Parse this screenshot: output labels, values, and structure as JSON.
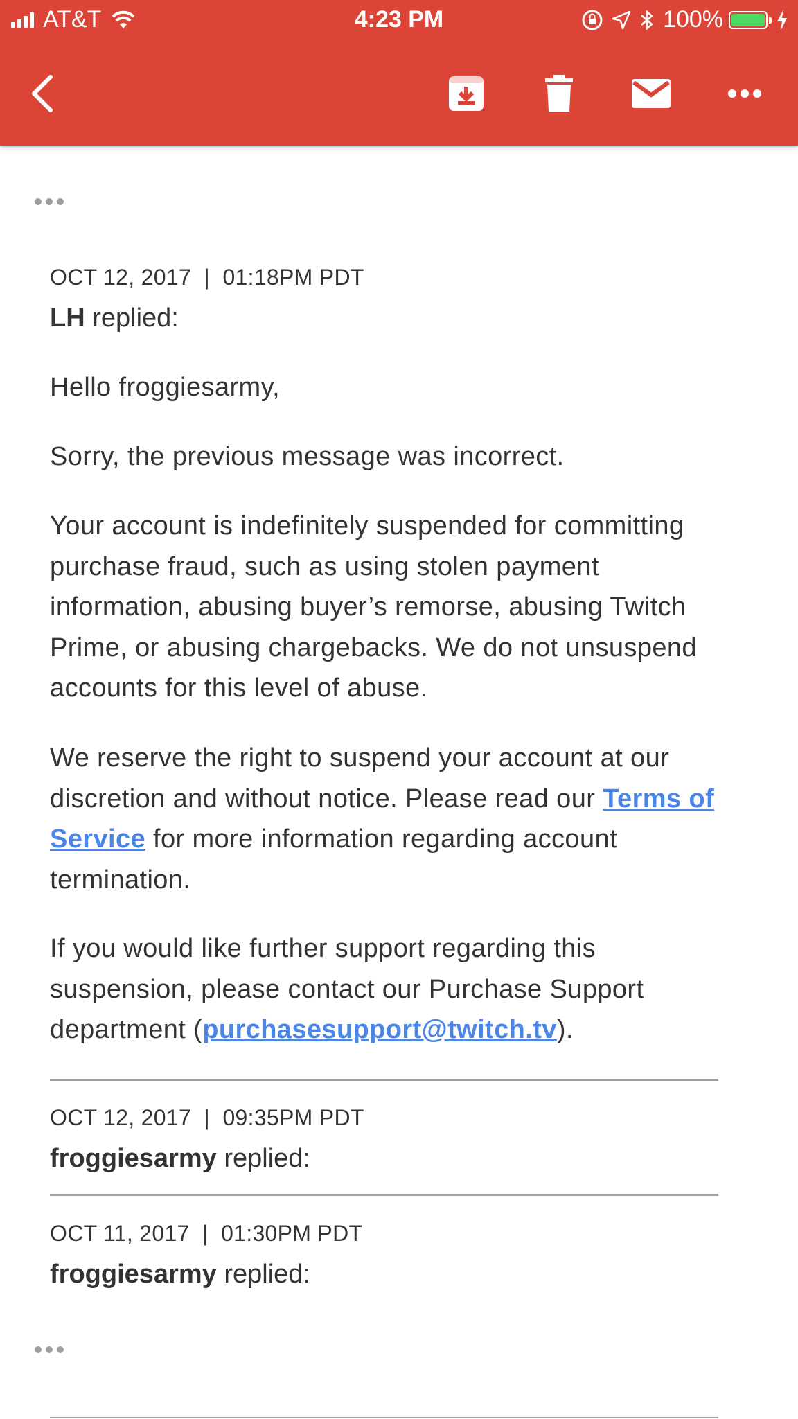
{
  "status_bar": {
    "carrier": "AT&T",
    "time": "4:23 PM",
    "battery": "100%"
  },
  "toolbar": {
    "back_icon": "chevron-left-icon",
    "archive_icon": "archive-icon",
    "delete_icon": "trash-icon",
    "mark_unread_icon": "envelope-icon",
    "more_icon": "more-horizontal-icon",
    "color": "#db4437"
  },
  "messages": [
    {
      "date": "OCT 12, 2017",
      "sep": "|",
      "time": "01:18PM PDT",
      "author": "LH",
      "replied": "replied:",
      "greeting": "Hello froggiesarmy,",
      "para1": "Sorry, the previous message was incorrect.",
      "para2": "Your account is indefinitely suspended for committing purchase fraud, such as using stolen payment information, abusing buyer’s remorse, abusing Twitch Prime, or abusing chargebacks. We do not unsuspend accounts for this level of abuse.",
      "para3_before": "We reserve the right to suspend your account at our discretion and without notice. Please read our ",
      "para3_link": "Terms of Service",
      "para3_after": " for more information regarding account termination.",
      "para4_before": "If you would like further support regarding this suspension, please contact our Purchase Support department (",
      "para4_link": "purchasesupport@twitch.tv",
      "para4_after": ")."
    },
    {
      "date": "OCT 12, 2017",
      "sep": "|",
      "time": "09:35PM PDT",
      "author": "froggiesarmy",
      "replied": "replied:"
    },
    {
      "date": "OCT 11, 2017",
      "sep": "|",
      "time": "01:30PM PDT",
      "author": "froggiesarmy",
      "replied": "replied:"
    }
  ],
  "colors": {
    "link": "#4a86e8",
    "text": "#333333",
    "divider": "#9e9e9e"
  }
}
